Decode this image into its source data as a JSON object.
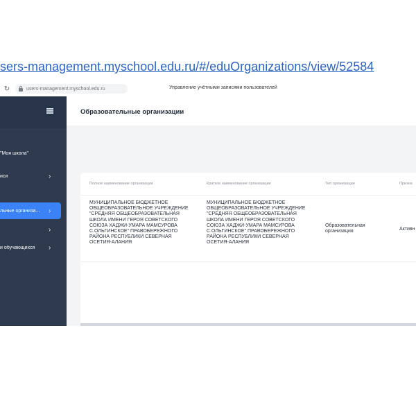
{
  "page_url": "sers-management.myschool.edu.ru/#/eduOrganizations/view/52584",
  "browser": {
    "reload_glyph": "↻",
    "address_text": "users-management.myschool.edu.ru",
    "tab_title": "Управление учётными записями пользователей"
  },
  "sidebar": {
    "org_name": "\"Моя школа\"",
    "items": [
      {
        "label": "иси",
        "chevron": "›"
      },
      {
        "label": "льные организа...",
        "chevron": "›"
      },
      {
        "label": "",
        "chevron": "›"
      },
      {
        "label": "и обучающихся",
        "chevron": "›"
      }
    ]
  },
  "main": {
    "title": "Образовательные организации",
    "table": {
      "headers": [
        "Полное наименование организации",
        "Краткое наименование организации",
        "Тип организации",
        "Призна"
      ],
      "rows": [
        {
          "full_name": "МУНИЦИПАЛЬНОЕ БЮДЖЕТНОЕ ОБЩЕОБРАЗОВАТЕЛЬНОЕ УЧРЕЖДЕНИЕ \"СРЕДНЯЯ ОБЩЕОБРАЗОВАТЕЛЬНАЯ ШКОЛА ИМЕНИ ГЕРОЯ СОВЕТСКОГО СОЮЗА ХАДЖИ-УМАРА МАМСУРОВА С.ОЛЬГИНСКОЕ\" ПРАВОБЕРЕЖНОГО РАЙОНА РЕСПУБЛИКИ СЕВЕРНАЯ ОСЕТИЯ-АЛАНИЯ",
          "short_name": "МУНИЦИПАЛЬНОЕ БЮДЖЕТНОЕ ОБЩЕОБРАЗОВАТЕЛЬНОЕ УЧРЕЖДЕНИЕ \"СРЕДНЯЯ ОБЩЕОБРАЗОВАТЕЛЬНАЯ ШКОЛА ИМЕНИ ГЕРОЯ СОВЕТСКОГО СОЮЗА ХАДЖИ-УМАРА МАМСУРОВА С.ОЛЬГИНСКОЕ\" ПРАВОБЕРЕЖНОГО РАЙОНА РЕСПУБЛИКИ СЕВЕРНАЯ ОСЕТИЯ-АЛАНИЯ",
          "org_type": "Образовательная организация",
          "status": "Активн"
        }
      ]
    }
  },
  "colors": {
    "url_link": "#2a64c5",
    "sidebar_bg": "#2e3a4e",
    "sidebar_active": "#3b82f6"
  }
}
